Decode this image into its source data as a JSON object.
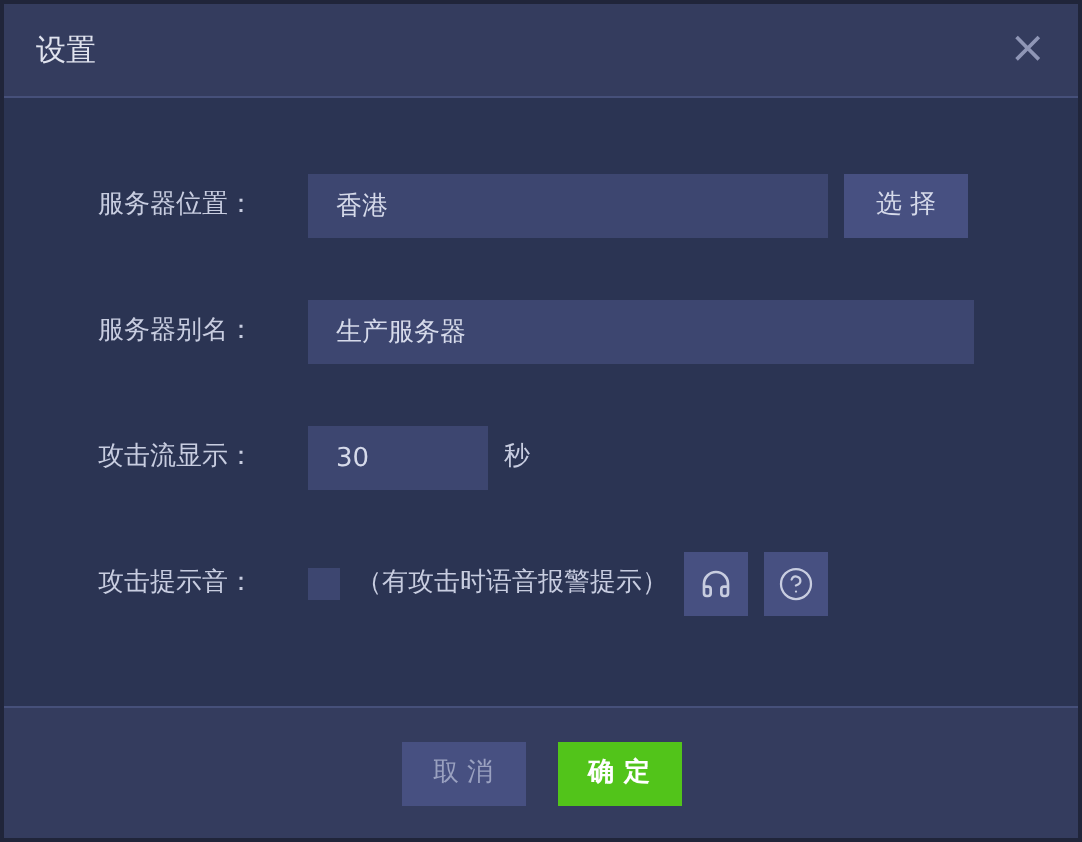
{
  "window": {
    "title": "设置",
    "close": "×"
  },
  "rows": [
    {
      "kind": "select",
      "label": "服务器位置：",
      "value": "香港",
      "button": "选 择"
    },
    {
      "kind": "text",
      "label": "服务器别名：",
      "value": "生产服务器"
    },
    {
      "kind": "number",
      "label": "攻击流显示：",
      "value": "30",
      "unit": "秒"
    },
    {
      "kind": "checkbox",
      "label": "攻击提示音：",
      "checked": false,
      "hint": "（有攻击时语音报警提示）"
    }
  ],
  "buttons": [
    {
      "label": "取 消",
      "kind": "secondary"
    },
    {
      "label": "确 定",
      "kind": "primary"
    }
  ]
}
